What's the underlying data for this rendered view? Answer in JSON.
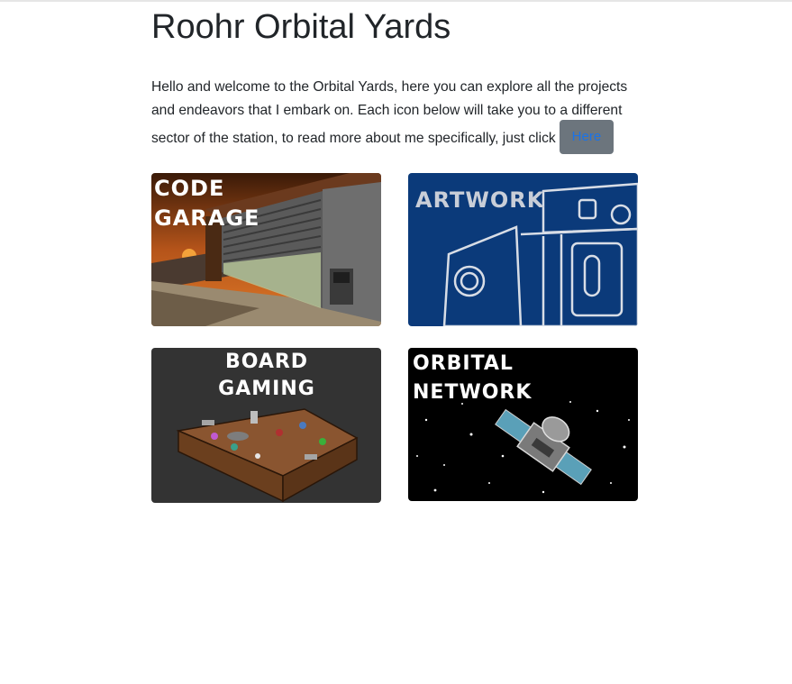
{
  "page": {
    "title": "Roohr Orbital Yards",
    "intro_lines": [
      "Hello and welcome to the Orbital Yards, here you can explore all the projects",
      "and endeavors that I embark on. Each icon below will take you to a different",
      "sector of the station, to read more about me specifically, just click"
    ],
    "here_button": "Here"
  },
  "tiles": [
    {
      "name": "code-garage",
      "lines": [
        "CODE",
        "GARAGE"
      ]
    },
    {
      "name": "artwork",
      "lines": [
        "ARTWORK"
      ]
    },
    {
      "name": "board-gaming",
      "lines": [
        "BOARD",
        "GAMING"
      ]
    },
    {
      "name": "orbital-network",
      "lines": [
        "ORBITAL",
        "NETWORK"
      ]
    }
  ],
  "colors": {
    "button_bg": "#6c757d",
    "button_text": "#1a73e8",
    "artwork_bg": "#0b3a7a",
    "board_bg": "#333333",
    "network_bg": "#000000"
  }
}
